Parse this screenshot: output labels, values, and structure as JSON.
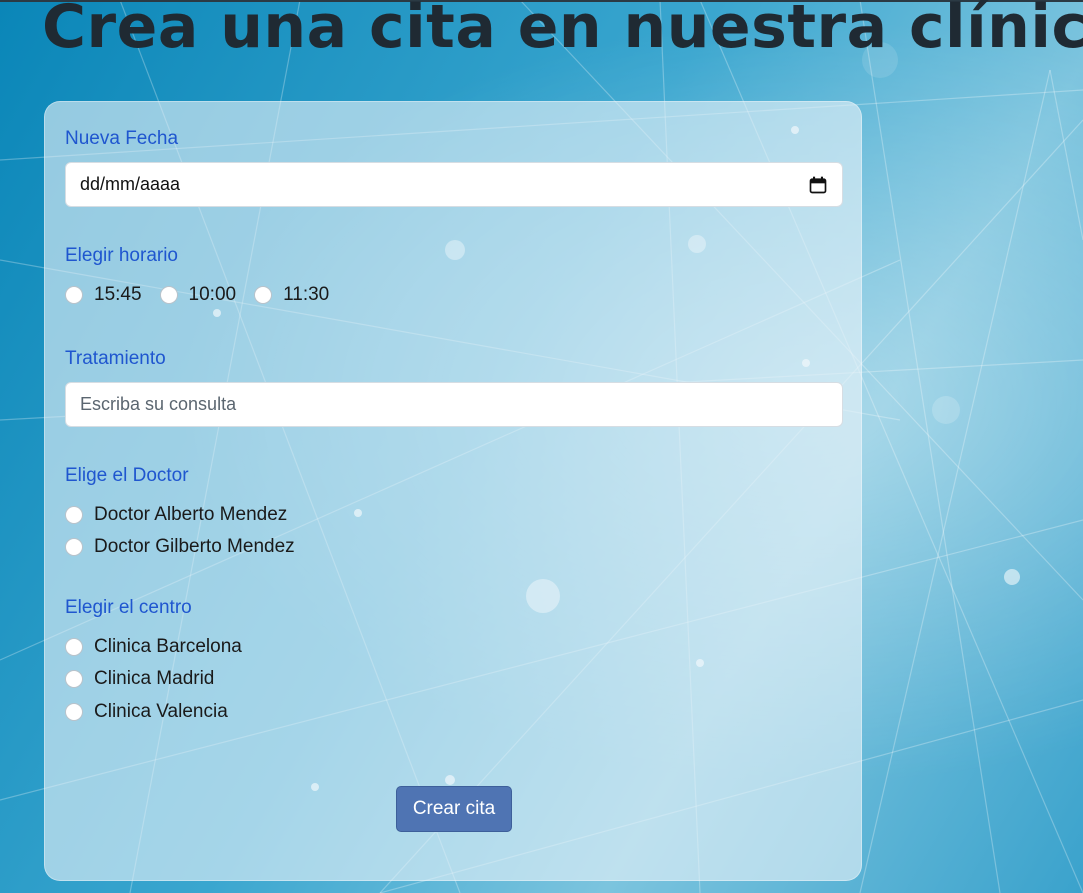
{
  "page": {
    "title": "Crea una cita en nuestra clínica"
  },
  "form": {
    "date": {
      "label": "Nueva Fecha",
      "value": "dd/mm/aaaa",
      "icon": "calendar-icon"
    },
    "schedule": {
      "label": "Elegir horario",
      "options": [
        "15:45",
        "10:00",
        "11:30"
      ]
    },
    "treatment": {
      "label": "Tratamiento",
      "placeholder": "Escriba su consulta"
    },
    "doctor": {
      "label": "Elige el Doctor",
      "options": [
        "Doctor Alberto Mendez",
        "Doctor Gilberto Mendez"
      ]
    },
    "center": {
      "label": "Elegir el centro",
      "options": [
        "Clinica Barcelona",
        "Clinica Madrid",
        "Clinica Valencia"
      ]
    },
    "submit_label": "Crear cita"
  },
  "colors": {
    "label": "#1f56cf",
    "button": "#4f74b3",
    "title": "#1f2a33"
  }
}
